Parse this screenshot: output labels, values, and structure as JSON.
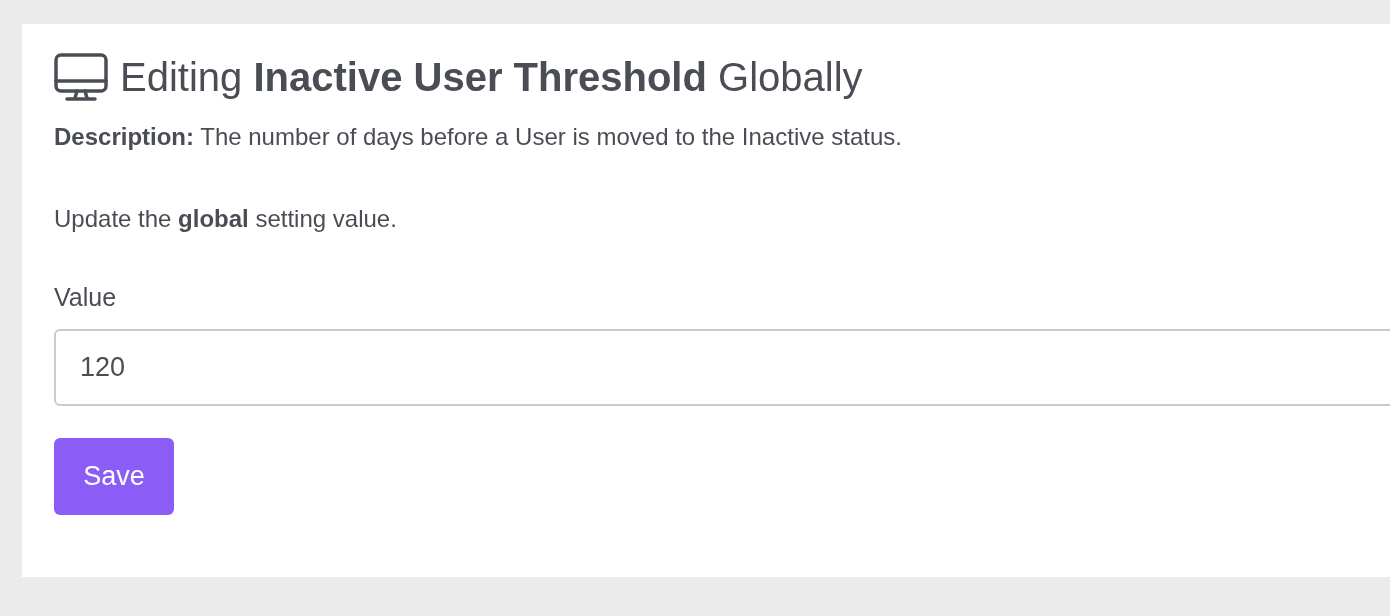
{
  "heading": {
    "prefix": "Editing",
    "setting": "Inactive User Threshold",
    "suffix": "Globally"
  },
  "description": "**Description:** The number of days before a User is moved to the Inactive status.",
  "instruction": "Update the **global** setting value.",
  "field": {
    "label": "Value",
    "value": "120"
  },
  "buttons": [
    {
      "label": "Save",
      "kind": "primary"
    }
  ]
}
